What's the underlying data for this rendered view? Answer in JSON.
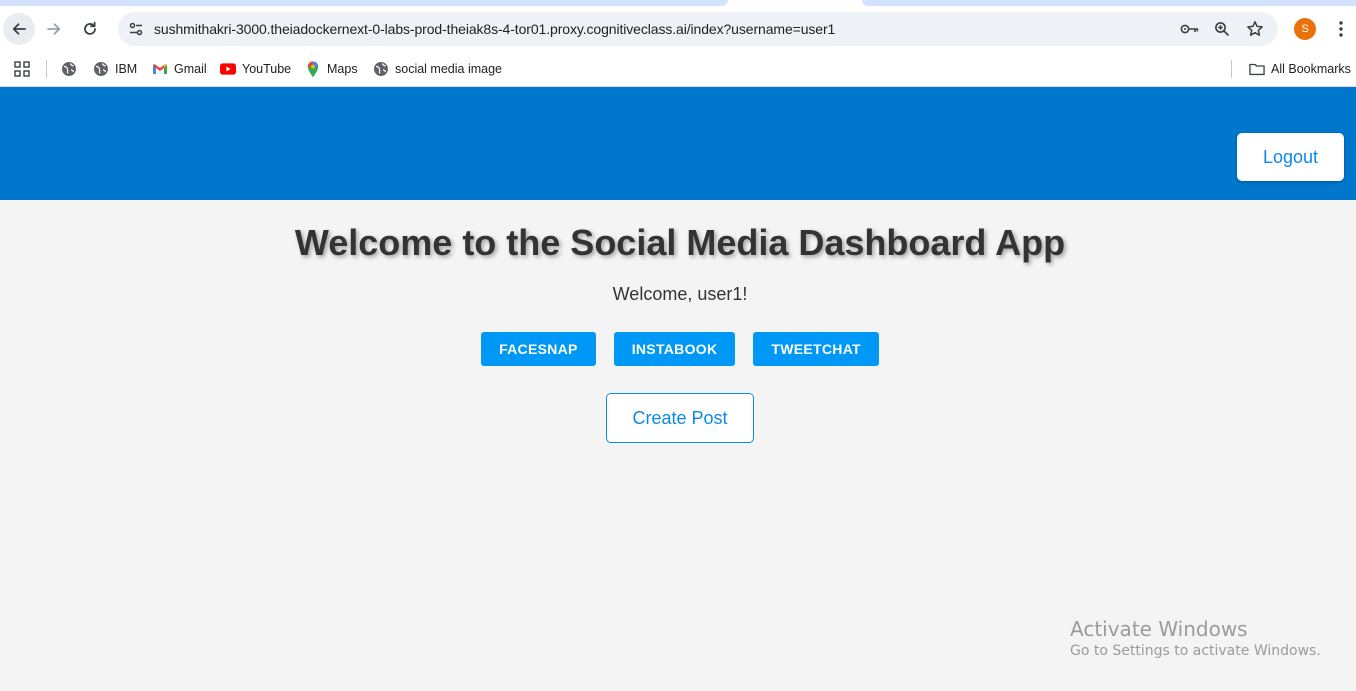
{
  "browser": {
    "url": "sushmithakri-3000.theiadockernext-0-labs-prod-theiak8s-4-tor01.proxy.cognitiveclass.ai/index?username=user1",
    "profile_initial": "S",
    "bookmarks": [
      {
        "label": "",
        "icon": "globe-icon"
      },
      {
        "label": "IBM",
        "icon": "globe-icon"
      },
      {
        "label": "Gmail",
        "icon": "gmail-icon"
      },
      {
        "label": "YouTube",
        "icon": "youtube-icon"
      },
      {
        "label": "Maps",
        "icon": "maps-icon"
      },
      {
        "label": "social media image",
        "icon": "globe-icon"
      }
    ],
    "all_bookmarks_label": "All Bookmarks"
  },
  "header": {
    "logout_label": "Logout",
    "color": "#0076cc"
  },
  "main": {
    "title": "Welcome to the Social Media Dashboard App",
    "welcome_text": "Welcome, user1!",
    "social_buttons": [
      "FACESNAP",
      "INSTABOOK",
      "TWEETCHAT"
    ],
    "create_post_label": "Create Post",
    "accent_color": "#0098f7"
  },
  "watermark": {
    "title": "Activate Windows",
    "subtitle": "Go to Settings to activate Windows."
  }
}
